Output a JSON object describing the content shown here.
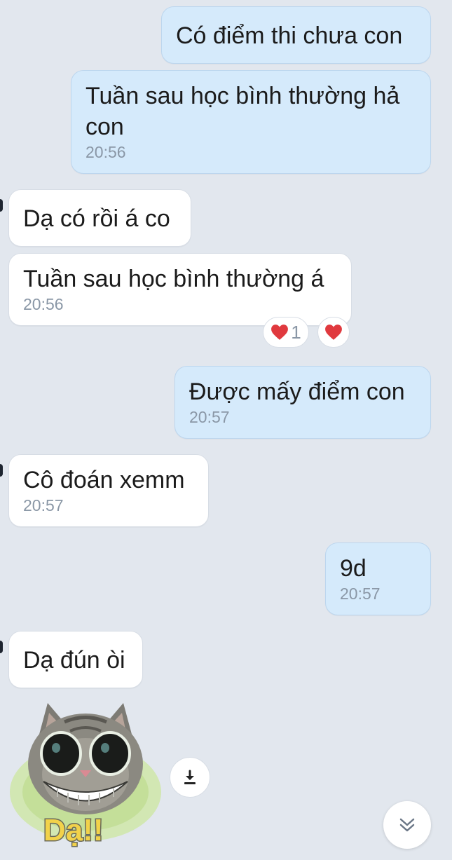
{
  "messages": [
    {
      "direction": "out",
      "text": "Có điểm thi chưa con",
      "time": ""
    },
    {
      "direction": "out",
      "text": "Tuần sau học bình thường hả\ncon",
      "time": "20:56"
    },
    {
      "direction": "in",
      "text": "Dạ có rồi á co",
      "time": ""
    },
    {
      "direction": "in",
      "text": "Tuần sau học bình thường á",
      "time": "20:56"
    },
    {
      "direction": "out",
      "text": "Được mấy điểm con",
      "time": "20:57"
    },
    {
      "direction": "in",
      "text": "Cô đoán xemm",
      "time": "20:57"
    },
    {
      "direction": "out",
      "text": "9d",
      "time": "20:57"
    },
    {
      "direction": "in",
      "text": "Dạ đún òi",
      "time": ""
    }
  ],
  "reactions": {
    "count_label": "1",
    "heart_icon": "heart-icon",
    "heart_color": "#e0393e"
  },
  "sticker": {
    "caption": "Dạ!!",
    "caption_color": "#f2d24a"
  },
  "icons": {
    "download": "download-icon",
    "scroll_down": "chevron-double-down-icon"
  },
  "colors": {
    "background": "#e2e7ee",
    "outgoing_bubble": "#d5eafb",
    "incoming_bubble": "#ffffff",
    "time_text": "#8a97a6"
  }
}
